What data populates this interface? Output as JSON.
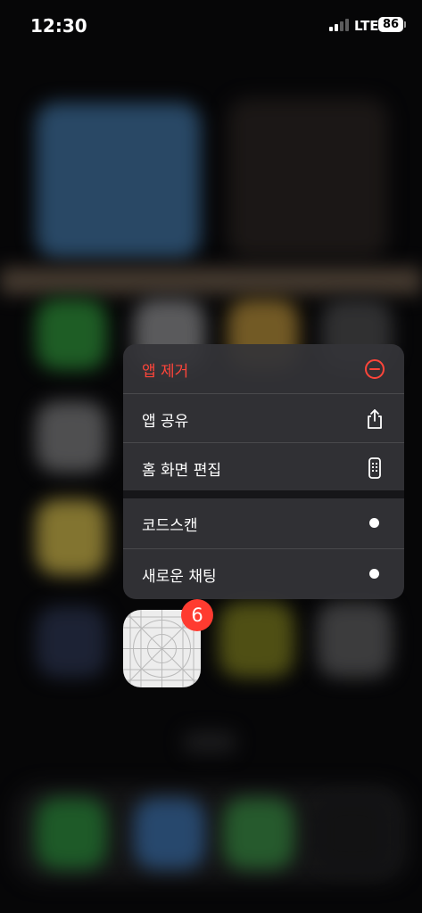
{
  "status_bar": {
    "time": "12:30",
    "network": "LTE",
    "battery": "86",
    "signal_bars_active": 2
  },
  "context_menu": {
    "items": [
      {
        "label": "앱 제거",
        "icon": "minus-circle-icon",
        "destructive": true
      },
      {
        "label": "앱 공유",
        "icon": "share-icon"
      },
      {
        "label": "홈 화면 편집",
        "icon": "phone-edit-icon"
      },
      {
        "label": "코드스캔",
        "icon": "dot-icon"
      },
      {
        "label": "새로운 채팅",
        "icon": "dot-icon"
      }
    ]
  },
  "app": {
    "badge_count": "6",
    "icon": "placeholder-app-grid-icon"
  },
  "colors": {
    "destructive": "#ff453a",
    "badge": "#ff3b30",
    "menu_background": "#343438"
  }
}
